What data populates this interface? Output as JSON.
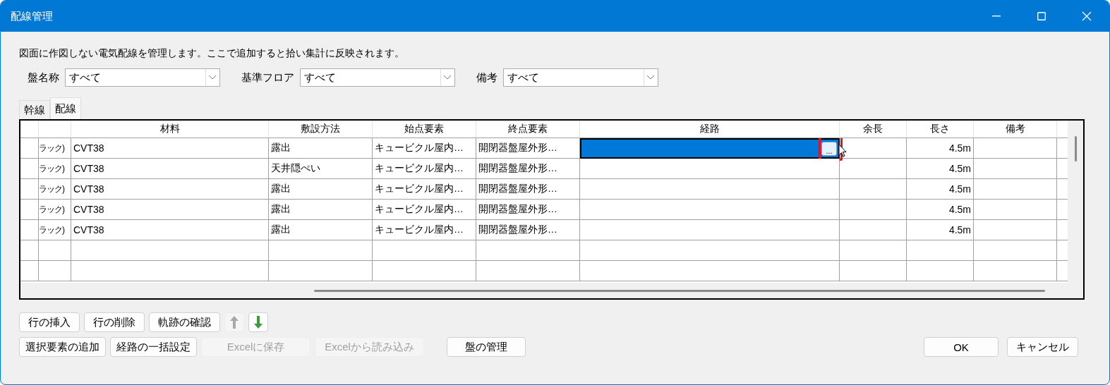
{
  "window": {
    "title": "配線管理"
  },
  "description": "図面に作図しない電気配線を管理します。ここで追加すると拾い集計に反映されます。",
  "filters": [
    {
      "label": "盤名称",
      "value": "すべて"
    },
    {
      "label": "基準フロア",
      "value": "すべて"
    },
    {
      "label": "備考",
      "value": "すべて"
    }
  ],
  "tabs": [
    {
      "label": "幹線",
      "selected": false
    },
    {
      "label": "配線",
      "selected": true
    }
  ],
  "table": {
    "columns": [
      "材料",
      "敷設方法",
      "始点要素",
      "終点要素",
      "経路",
      "余長",
      "長さ",
      "備考"
    ],
    "rows": [
      {
        "column_1": "ラック)",
        "material": "CVT38",
        "method": "露出",
        "start": "キュービクル屋内…",
        "end": "開閉器盤屋外形…",
        "length": "4.5m",
        "selected": true,
        "route_button": "..."
      },
      {
        "column_1": "ラック)",
        "material": "CVT38",
        "method": "天井隠ぺい",
        "start": "キュービクル屋内…",
        "end": "開閉器盤屋外形…",
        "length": "4.5m",
        "selected": false
      },
      {
        "column_1": "ラック)",
        "material": "CVT38",
        "method": "露出",
        "start": "キュービクル屋内…",
        "end": "開閉器盤屋外形…",
        "length": "4.5m",
        "selected": false
      },
      {
        "column_1": "ラック)",
        "material": "CVT38",
        "method": "露出",
        "start": "キュービクル屋内…",
        "end": "開閉器盤屋外形…",
        "length": "4.5m",
        "selected": false
      },
      {
        "column_1": "ラック)",
        "material": "CVT38",
        "method": "露出",
        "start": "キュービクル屋内…",
        "end": "開閉器盤屋外形…",
        "length": "4.5m",
        "selected": false
      },
      {
        "selected": false
      },
      {
        "selected": false
      }
    ]
  },
  "row_buttons": [
    {
      "kind": "text",
      "label": "行の挿入",
      "disabled": false
    },
    {
      "kind": "text",
      "label": "行の削除",
      "disabled": false
    },
    {
      "kind": "text",
      "label": "軌跡の確認",
      "disabled": false
    },
    {
      "kind": "up",
      "disabled": true
    },
    {
      "kind": "down",
      "disabled": false
    }
  ],
  "action_buttons": [
    {
      "label": "選択要素の追加",
      "disabled": false
    },
    {
      "label": "経路の一括設定",
      "disabled": false
    },
    {
      "label": "Excelに保存",
      "disabled": true
    },
    {
      "label": "Excelから読み込み",
      "disabled": true
    },
    {
      "label": "盤の管理",
      "disabled": false
    }
  ],
  "dialog_buttons": [
    "OK",
    "キャンセル"
  ]
}
